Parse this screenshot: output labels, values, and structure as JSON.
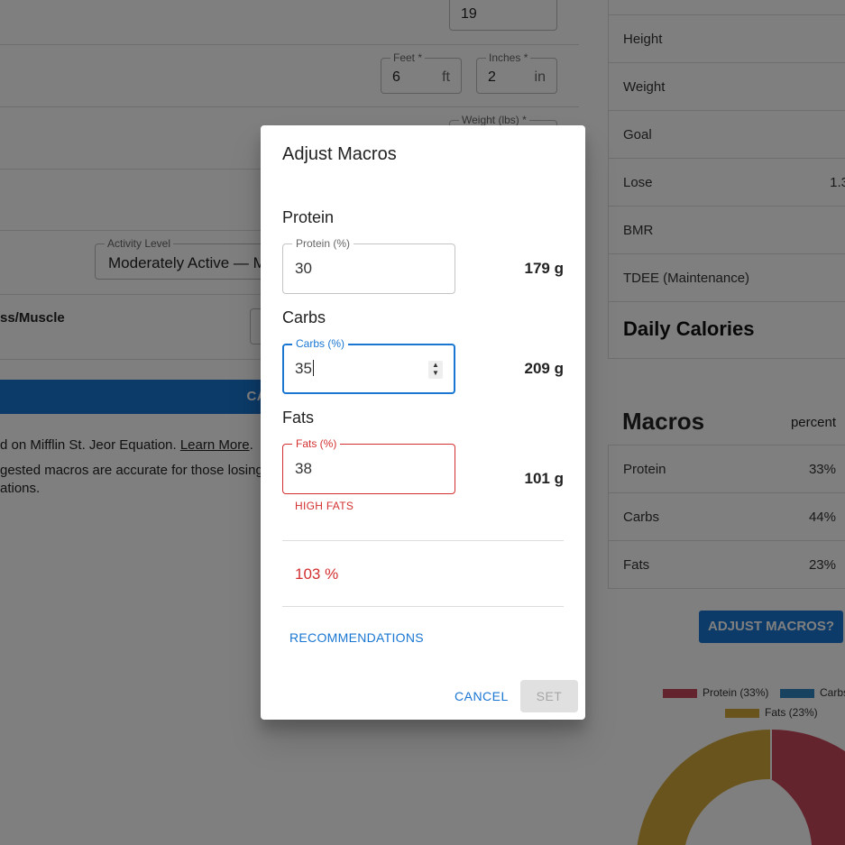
{
  "background": {
    "age_field": {
      "value": "19"
    },
    "feet_field": {
      "label": "Feet *",
      "value": "6",
      "unit": "ft"
    },
    "inches_field": {
      "label": "Inches *",
      "value": "2",
      "unit": "in"
    },
    "weight_field": {
      "label": "Weight (lbs) *"
    },
    "activity_field": {
      "label": "Activity Level",
      "value": "Moderately Active — M"
    },
    "loss_label": "ss/Muscle",
    "calculate_label": "CALCULATE",
    "footnote_1_prefix": "d on Mifflin St. Jeor Equation. ",
    "footnote_1_link": "Learn More",
    "footnote_1_suffix": ".",
    "footnote_2": "gested macros are accurate for those losing",
    "footnote_3": "ations."
  },
  "results": {
    "rows": [
      {
        "key": "Height",
        "value": ""
      },
      {
        "key": "Weight",
        "value": ""
      },
      {
        "key": "Goal",
        "value": ""
      },
      {
        "key": "Lose",
        "value": "1.3"
      },
      {
        "key": "BMR",
        "value": ""
      },
      {
        "key": "TDEE (Maintenance)",
        "value": ""
      },
      {
        "key": "Daily Calories",
        "value": ""
      }
    ],
    "macros_title": "Macros",
    "macros_col": "percent",
    "macro_rows": [
      {
        "key": "Protein",
        "value": "33%"
      },
      {
        "key": "Carbs",
        "value": "44%"
      },
      {
        "key": "Fats",
        "value": "23%"
      }
    ],
    "adjust_label": "ADJUST MACROS?",
    "legend": [
      {
        "label": "Protein (33%)",
        "color": "#c9485b"
      },
      {
        "label": "Carbs",
        "color": "#2e86c1"
      },
      {
        "label": "Fats (23%)",
        "color": "#d4a93c"
      }
    ]
  },
  "dialog": {
    "title": "Adjust Macros",
    "protein": {
      "heading": "Protein",
      "label": "Protein (%)",
      "value": "30",
      "grams": "179 g"
    },
    "carbs": {
      "heading": "Carbs",
      "label": "Carbs (%)",
      "value": "35",
      "grams": "209 g"
    },
    "fats": {
      "heading": "Fats",
      "label": "Fats (%)",
      "value": "38",
      "grams": "101 g",
      "error": "HIGH FATS"
    },
    "total": "103 %",
    "recommendations_label": "RECOMMENDATIONS",
    "cancel_label": "CANCEL",
    "set_label": "SET"
  }
}
